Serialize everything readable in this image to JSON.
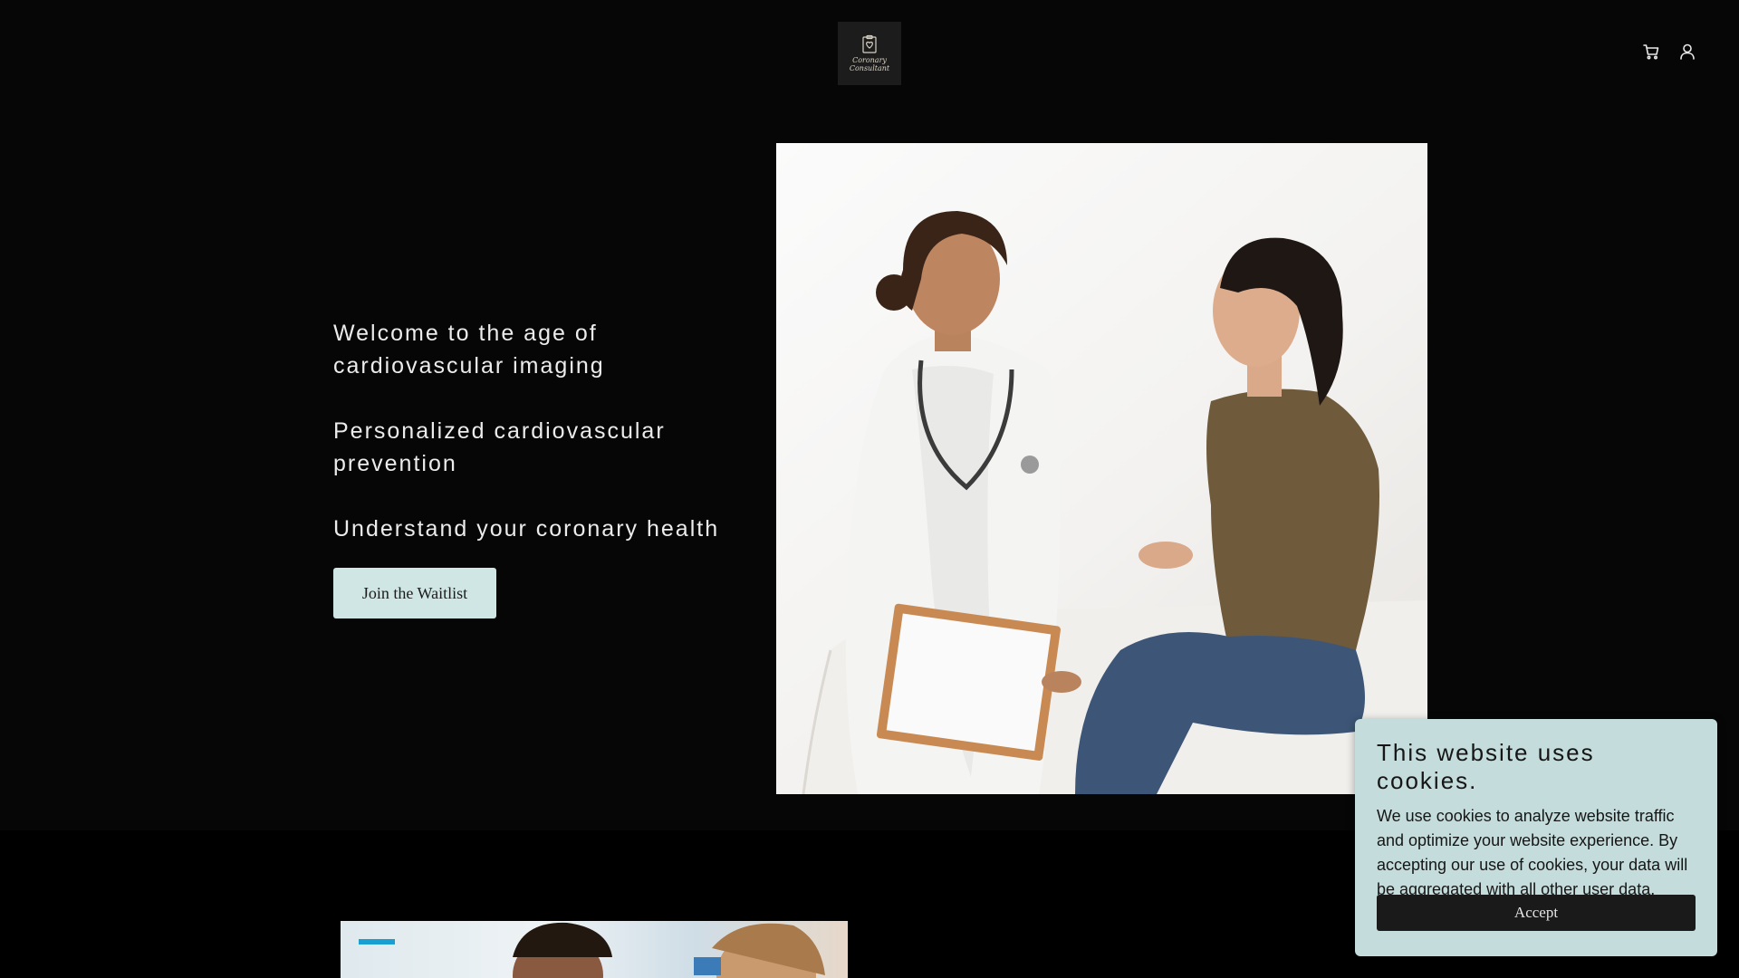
{
  "header": {
    "logo_text_line1": "Coronary",
    "logo_text_line2": "Consultant",
    "cart_icon": "cart-icon",
    "account_icon": "user-icon"
  },
  "hero": {
    "lines": [
      "Welcome to the age of cardiovascular imaging",
      "Personalized cardiovascular prevention",
      "Understand your coronary health"
    ],
    "cta_label": "Join the Waitlist"
  },
  "cookie_banner": {
    "title": "This website uses cookies.",
    "body": "We use cookies to analyze website traffic and optimize your website experience. By accepting our use of cookies, your data will be aggregated with all other user data.",
    "accept_label": "Accept"
  },
  "colors": {
    "background": "#060607",
    "button_accent": "#cfe6e4",
    "cookie_bg": "#c4dcdb",
    "accept_bg": "#1a1a1a"
  }
}
